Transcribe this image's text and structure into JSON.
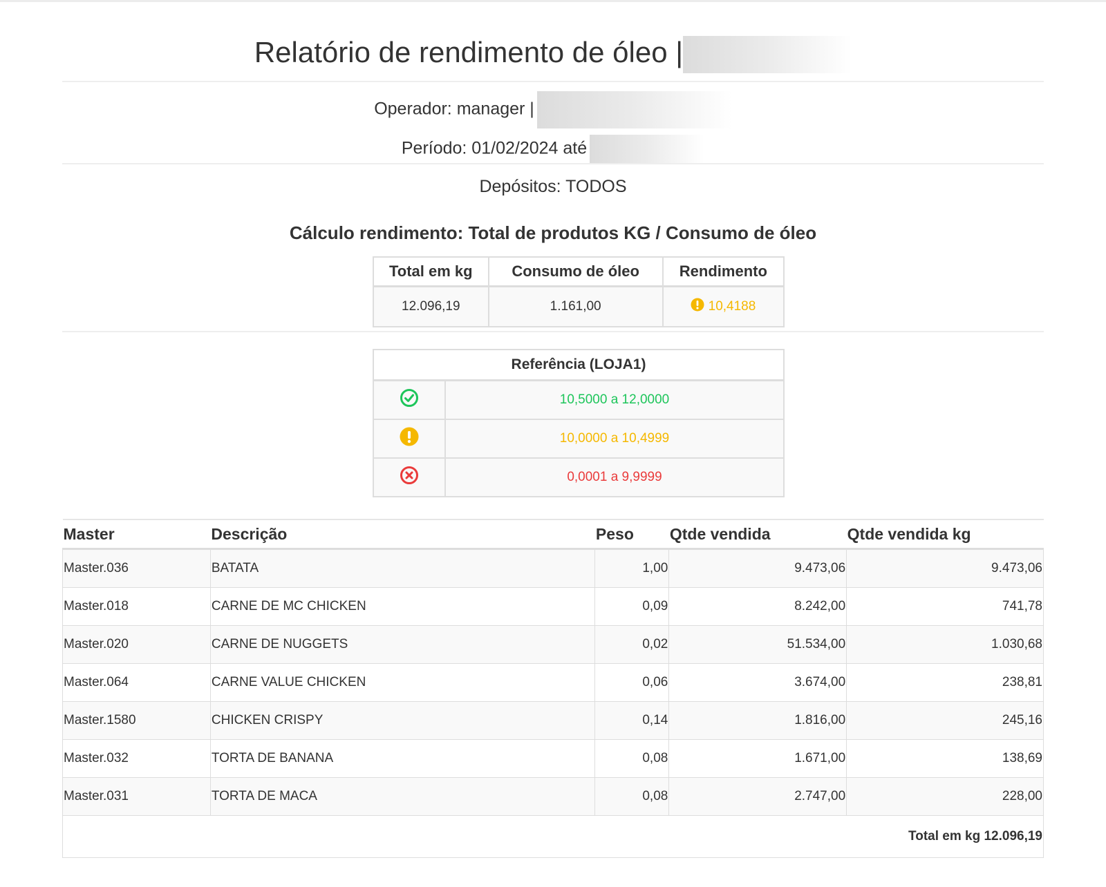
{
  "header": {
    "title": "Relatório de rendimento de óleo |",
    "operator": "Operador: manager |",
    "period": "Período: 01/02/2024 até",
    "deposits": "Depósitos: TODOS",
    "calc": "Cálculo rendimento: Total de produtos KG / Consumo de óleo"
  },
  "summary": {
    "headers": [
      "Total em kg",
      "Consumo de óleo",
      "Rendimento"
    ],
    "total_kg": "12.096,19",
    "consumo": "1.161,00",
    "rendimento": "10,4188",
    "rendimento_icon": "warning-circle-icon",
    "rendimento_color": "#f5b800"
  },
  "reference": {
    "title": "Referência (LOJA1)",
    "rows": [
      {
        "icon": "check-circle-icon",
        "range": "10,5000 a 12,0000",
        "color": "#1dc55a"
      },
      {
        "icon": "warning-circle-icon",
        "range": "10,0000 a 10,4999",
        "color": "#f5b800"
      },
      {
        "icon": "x-circle-icon",
        "range": "0,0001 a 9,9999",
        "color": "#ea3b3b"
      }
    ]
  },
  "products": {
    "headers": [
      "Master",
      "Descrição",
      "Peso",
      "Qtde vendida",
      "Qtde vendida kg"
    ],
    "rows": [
      [
        "Master.036",
        "BATATA",
        "1,00",
        "9.473,06",
        "9.473,06"
      ],
      [
        "Master.018",
        "CARNE DE MC CHICKEN",
        "0,09",
        "8.242,00",
        "741,78"
      ],
      [
        "Master.020",
        "CARNE DE NUGGETS",
        "0,02",
        "51.534,00",
        "1.030,68"
      ],
      [
        "Master.064",
        "CARNE VALUE CHICKEN",
        "0,06",
        "3.674,00",
        "238,81"
      ],
      [
        "Master.1580",
        "CHICKEN CRISPY",
        "0,14",
        "1.816,00",
        "245,16"
      ],
      [
        "Master.032",
        "TORTA DE BANANA",
        "0,08",
        "1.671,00",
        "138,69"
      ],
      [
        "Master.031",
        "TORTA DE MACA",
        "0,08",
        "2.747,00",
        "228,00"
      ]
    ],
    "total": "Total em kg 12.096,19"
  }
}
